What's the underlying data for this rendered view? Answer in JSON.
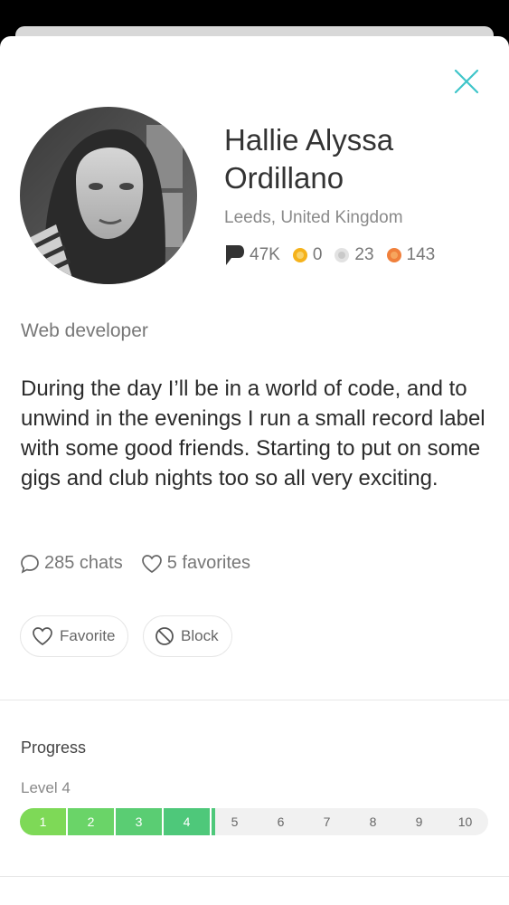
{
  "profile": {
    "name": "Hallie Alyssa Ordillano",
    "location": "Leeds, United Kingdom",
    "job": "Web developer",
    "bio": "During the day I’ll be in a world of code, and to unwind in the evenings I run a small record label with some good friends. Starting to put on some gigs and club nights too so all very exciting."
  },
  "stats": [
    {
      "icon": "flag-icon",
      "value": "47K",
      "color": "#333333"
    },
    {
      "icon": "gold-coin-icon",
      "value": "0",
      "color": "#f5b21b"
    },
    {
      "icon": "silver-coin-icon",
      "value": "23",
      "color": "#c9c9c9"
    },
    {
      "icon": "bronze-coin-icon",
      "value": "143",
      "color": "#f0803c"
    }
  ],
  "counts": {
    "chats": "285 chats",
    "favorites": "5 favorites"
  },
  "actions": {
    "favorite": "Favorite",
    "block": "Block"
  },
  "progress": {
    "title": "Progress",
    "level_label": "Level 4",
    "current_level": 4,
    "levels": [
      "1",
      "2",
      "3",
      "4",
      "5",
      "6",
      "7",
      "8",
      "9",
      "10"
    ]
  },
  "colors": {
    "close": "#3ec5c9",
    "progress_green": "#4ec87a"
  }
}
